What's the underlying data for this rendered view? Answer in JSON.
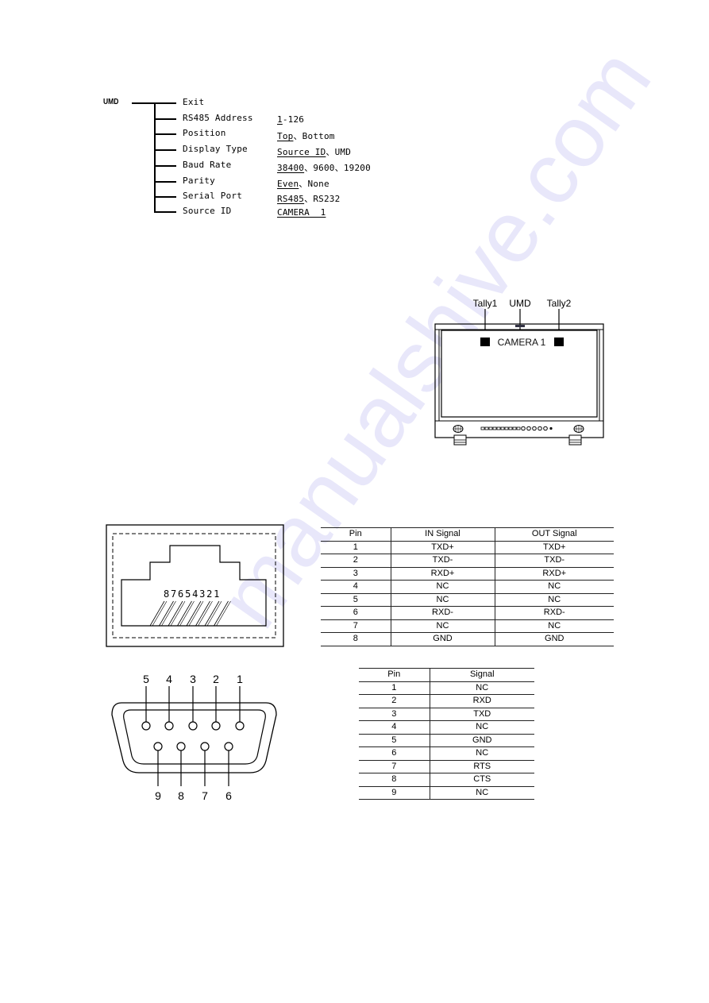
{
  "umd_menu": {
    "root": "UMD",
    "items": [
      {
        "label": "Exit",
        "values": []
      },
      {
        "label": "RS485 Address",
        "default": "1",
        "values": [
          "-126"
        ]
      },
      {
        "label": "Position",
        "default": "Top",
        "values": [
          "、Bottom"
        ]
      },
      {
        "label": "Display Type",
        "default": "Source ID",
        "values": [
          "、UMD"
        ]
      },
      {
        "label": "Baud Rate",
        "default": "38400",
        "values": [
          "、9600、19200"
        ]
      },
      {
        "label": "Parity",
        "default": "Even",
        "values": [
          "、None"
        ]
      },
      {
        "label": "Serial Port",
        "default": "RS485",
        "values": [
          "、RS232"
        ]
      },
      {
        "label": "Source ID",
        "default": "CAMERA  1",
        "values": []
      }
    ]
  },
  "monitor_diagram": {
    "labels": {
      "tally1": "Tally1",
      "umd": "UMD",
      "tally2": "Tally2"
    },
    "screen_text": "CAMERA 1"
  },
  "rj45": {
    "pin_numbers": "87654321",
    "table": {
      "headers": [
        "Pin",
        "IN Signal",
        "OUT Signal"
      ],
      "rows": [
        [
          "1",
          "TXD+",
          "TXD+"
        ],
        [
          "2",
          "TXD-",
          "TXD-"
        ],
        [
          "3",
          "RXD+",
          "RXD+"
        ],
        [
          "4",
          "NC",
          "NC"
        ],
        [
          "5",
          "NC",
          "NC"
        ],
        [
          "6",
          "RXD-",
          "RXD-"
        ],
        [
          "7",
          "NC",
          "NC"
        ],
        [
          "8",
          "GND",
          "GND"
        ]
      ]
    }
  },
  "db9": {
    "top_pins": [
      "5",
      "4",
      "3",
      "2",
      "1"
    ],
    "bottom_pins": [
      "9",
      "8",
      "7",
      "6"
    ],
    "table": {
      "headers": [
        "Pin",
        "Signal"
      ],
      "rows": [
        [
          "1",
          "NC"
        ],
        [
          "2",
          "RXD"
        ],
        [
          "3",
          "TXD"
        ],
        [
          "4",
          "NC"
        ],
        [
          "5",
          "GND"
        ],
        [
          "6",
          "NC"
        ],
        [
          "7",
          "RTS"
        ],
        [
          "8",
          "CTS"
        ],
        [
          "9",
          "NC"
        ]
      ]
    }
  },
  "watermark": "manualshive.com"
}
